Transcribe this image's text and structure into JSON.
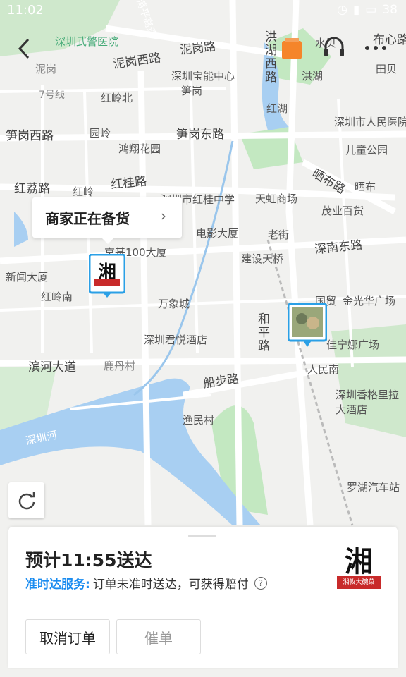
{
  "status_bar": {
    "time": "11:02",
    "battery": "38"
  },
  "map": {
    "labels": [
      {
        "text": "泥岗西路",
        "cls": "road"
      },
      {
        "text": "泥岗路",
        "cls": "road"
      },
      {
        "text": "深圳武警医院",
        "cls": ""
      },
      {
        "text": "泥岗",
        "cls": ""
      },
      {
        "text": "深圳宝能中心",
        "cls": ""
      },
      {
        "text": "笋岗",
        "cls": ""
      },
      {
        "text": "7号线",
        "cls": "gray"
      },
      {
        "text": "红岭北",
        "cls": ""
      },
      {
        "text": "笋岗西路",
        "cls": "road"
      },
      {
        "text": "园岭",
        "cls": ""
      },
      {
        "text": "笋岗东路",
        "cls": "road"
      },
      {
        "text": "鸿翔花园",
        "cls": ""
      },
      {
        "text": "红荔路",
        "cls": "road"
      },
      {
        "text": "红岭",
        "cls": ""
      },
      {
        "text": "红桂路",
        "cls": "road"
      },
      {
        "text": "深圳市红桂中学",
        "cls": ""
      },
      {
        "text": "天虹商场",
        "cls": ""
      },
      {
        "text": "茂业百货",
        "cls": ""
      },
      {
        "text": "电影大厦",
        "cls": ""
      },
      {
        "text": "老街",
        "cls": ""
      },
      {
        "text": "京基100大厦",
        "cls": ""
      },
      {
        "text": "建设天桥",
        "cls": ""
      },
      {
        "text": "深南东路",
        "cls": "road"
      },
      {
        "text": "新闻大厦",
        "cls": ""
      },
      {
        "text": "红岭南",
        "cls": ""
      },
      {
        "text": "万象城",
        "cls": ""
      },
      {
        "text": "国贸",
        "cls": ""
      },
      {
        "text": "金光华广场",
        "cls": ""
      },
      {
        "text": "深圳君悦酒店",
        "cls": ""
      },
      {
        "text": "佳宁娜广场",
        "cls": ""
      },
      {
        "text": "滨河大道",
        "cls": "road"
      },
      {
        "text": "鹿丹村",
        "cls": ""
      },
      {
        "text": "人民南",
        "cls": ""
      },
      {
        "text": "船步路",
        "cls": "road"
      },
      {
        "text": "深圳香格里拉大酒店",
        "cls": ""
      },
      {
        "text": "渔民村",
        "cls": ""
      },
      {
        "text": "深圳河",
        "cls": "blue"
      },
      {
        "text": "罗湖汽车站",
        "cls": ""
      },
      {
        "text": "洪湖西路",
        "cls": "road"
      },
      {
        "text": "洪湖",
        "cls": ""
      },
      {
        "text": "水贝",
        "cls": ""
      },
      {
        "text": "布心路",
        "cls": "road"
      },
      {
        "text": "田贝",
        "cls": ""
      },
      {
        "text": "红湖",
        "cls": ""
      },
      {
        "text": "深圳市人民医院",
        "cls": ""
      },
      {
        "text": "儿童公园",
        "cls": ""
      },
      {
        "text": "晒布路",
        "cls": "road"
      },
      {
        "text": "晒布",
        "cls": ""
      },
      {
        "text": "和平路",
        "cls": "road"
      },
      {
        "text": "清平高速",
        "cls": "gray"
      }
    ]
  },
  "order_status": {
    "text": "商家正在备货"
  },
  "sheet": {
    "eta": "预计11:55送达",
    "promise_key": "准时达服务:",
    "promise_text": "订单未准时送达，可获得赔付",
    "cancel_label": "取消订单",
    "urge_label": "催单"
  },
  "shop_logo_text": "湘",
  "shop_logo_sub": "湘攸大碗菜",
  "colors": {
    "accent": "#1a8cf0",
    "water": "#a8cff2",
    "green": "#c3e8c1"
  }
}
